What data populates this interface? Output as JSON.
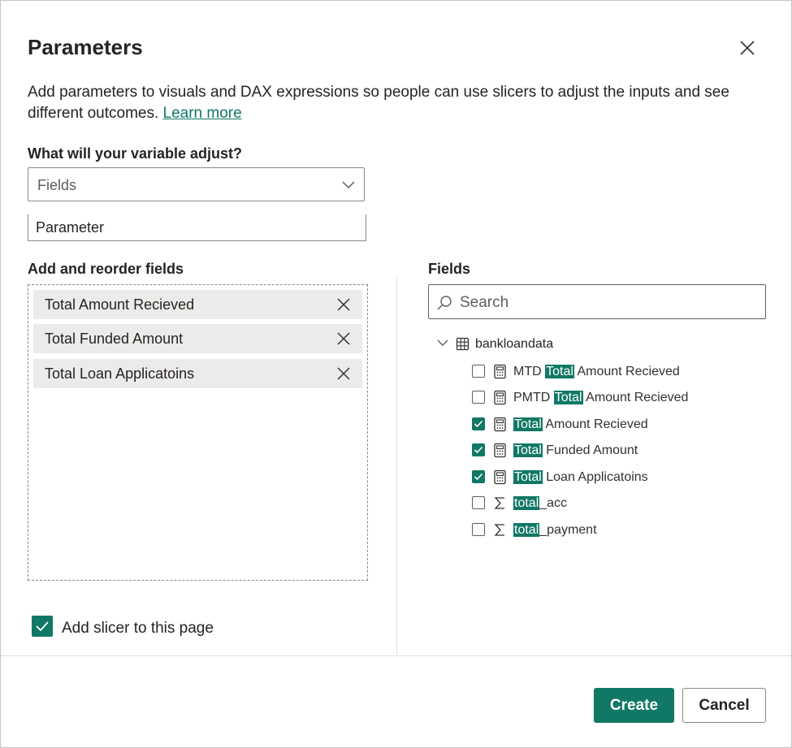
{
  "dialog": {
    "title": "Parameters",
    "description": "Add parameters to visuals and DAX expressions so people can use slicers to adjust the inputs and see different outcomes.",
    "learn_more": "Learn more"
  },
  "variable": {
    "label": "What will your variable adjust?",
    "selected": "Fields"
  },
  "name_input": {
    "value": "Parameter"
  },
  "reorder": {
    "label": "Add and reorder fields",
    "items": [
      {
        "label": "Total Amount Recieved"
      },
      {
        "label": "Total Funded Amount"
      },
      {
        "label": "Total Loan Applicatoins"
      }
    ]
  },
  "fields_panel": {
    "label": "Fields",
    "search_placeholder": "Search",
    "table": "bankloandata",
    "items": [
      {
        "prefix": "MTD ",
        "match": "Total",
        "suffix": " Amount Recieved",
        "checked": false,
        "icon": "calculator-icon"
      },
      {
        "prefix": "PMTD ",
        "match": "Total",
        "suffix": " Amount Recieved",
        "checked": false,
        "icon": "calculator-icon"
      },
      {
        "prefix": "",
        "match": "Total",
        "suffix": " Amount Recieved",
        "checked": true,
        "icon": "calculator-icon"
      },
      {
        "prefix": "",
        "match": "Total",
        "suffix": " Funded Amount",
        "checked": true,
        "icon": "calculator-icon"
      },
      {
        "prefix": "",
        "match": "Total",
        "suffix": " Loan Applicatoins",
        "checked": true,
        "icon": "calculator-icon"
      },
      {
        "prefix": "",
        "match": "total",
        "suffix": "_acc",
        "checked": false,
        "icon": "sigma-icon"
      },
      {
        "prefix": "",
        "match": "total",
        "suffix": "_payment",
        "checked": false,
        "icon": "sigma-icon"
      }
    ]
  },
  "slicer": {
    "label": "Add slicer to this page",
    "checked": true
  },
  "buttons": {
    "create": "Create",
    "cancel": "Cancel"
  },
  "colors": {
    "accent": "#117865",
    "chip_bg": "#edebe9"
  }
}
